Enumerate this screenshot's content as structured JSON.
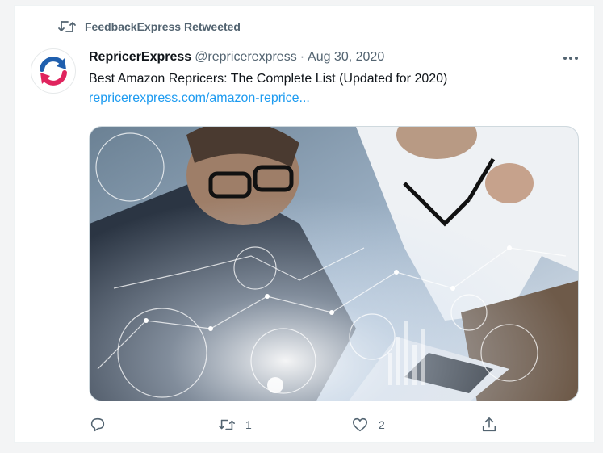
{
  "retweet_banner": {
    "text": "FeedbackExpress Retweeted",
    "icon": "retweet-icon"
  },
  "tweet": {
    "display_name": "RepricerExpress",
    "handle": "@repricerexpress",
    "separator": "·",
    "date": "Aug 30, 2020",
    "text": "Best Amazon Repricers: The Complete List (Updated for 2020)",
    "link": "repricerexpress.com/amazon-reprice...",
    "more_icon": "more-icon",
    "avatar_icon": "repricerexpress-logo"
  },
  "actions": {
    "reply": {
      "icon": "reply-icon",
      "count": ""
    },
    "retweet": {
      "icon": "retweet-icon",
      "count": "1"
    },
    "like": {
      "icon": "heart-icon",
      "count": "2"
    },
    "share": {
      "icon": "share-icon",
      "count": ""
    }
  },
  "colors": {
    "accent": "#1d9bf0",
    "text": "#0f1419",
    "muted": "#536471",
    "logo_red": "#e0245e",
    "logo_blue": "#1f5fae"
  }
}
